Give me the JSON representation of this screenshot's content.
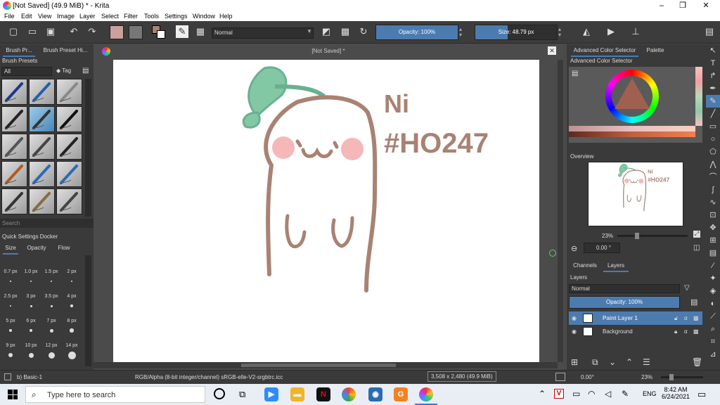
{
  "window": {
    "title": "[Not Saved]  (49.9 MiB)  * - Krita",
    "min": "–",
    "restore": "❐",
    "close": "✕"
  },
  "menu": [
    "File",
    "Edit",
    "View",
    "Image",
    "Layer",
    "Select",
    "Filter",
    "Tools",
    "Settings",
    "Window",
    "Help"
  ],
  "toolbar": {
    "blend_mode": "Normal",
    "opacity_label": "Opacity: 100%",
    "opacity_fraction": 1.0,
    "size_label": "Size: 48.79 px",
    "size_fraction": 0.4,
    "fg_color": "#c9a09a",
    "bg_color": "#777777"
  },
  "brush_presets": {
    "tab1": "Brush Pr...",
    "tab2": "Brush Preset Hi...",
    "header": "Brush Presets",
    "filter": "All",
    "tag": "Tag",
    "search_placeholder": "Search"
  },
  "quick_settings": {
    "header": "Quick Settings Docker",
    "tabs": [
      "Size",
      "Opacity",
      "Flow"
    ],
    "sizes": [
      "0.7 px",
      "1.0 px",
      "1.5 px",
      "2 px",
      "2.5 px",
      "3 px",
      "3.5 px",
      "4 px",
      "5 px",
      "6 px",
      "7 px",
      "8 px",
      "9 px",
      "10 px",
      "12 px",
      "14 px"
    ],
    "footer": "b) Basic-1"
  },
  "canvas": {
    "doc_title": "[Not Saved]  *",
    "drawing_text1": "Ni",
    "drawing_text2": "#HO247",
    "line_color": "#a88273",
    "leaf_color": "#82c8a5",
    "cheek_color": "#f5b8b8"
  },
  "color_selector": {
    "tab1": "Advanced Color Selector",
    "tab2": "Palette",
    "header": "Advanced Color Selector"
  },
  "overview": {
    "header": "Overview",
    "zoom_percent": "23%",
    "rotation": "0.00 °"
  },
  "layers": {
    "tab1": "Channels",
    "tab2": "Layers",
    "header": "Layers",
    "blend_mode": "Normal",
    "opacity_label": "Opacity:  100%",
    "items": [
      {
        "name": "Paint Layer 1",
        "selected": true
      },
      {
        "name": "Background",
        "selected": false
      }
    ]
  },
  "status": {
    "color_model": "RGB/Alpha (8-bit integer/channel)  sRGB-elle-V2-srgbtrc.icc",
    "doc_size": "3,508 x 2,480 (49.9 MiB)",
    "rotation": "0.00°",
    "zoom": "23%"
  },
  "taskbar": {
    "search_placeholder": "Type here to search",
    "lang": "ENG",
    "time": "8:42 AM",
    "date": "6/24/2021"
  }
}
